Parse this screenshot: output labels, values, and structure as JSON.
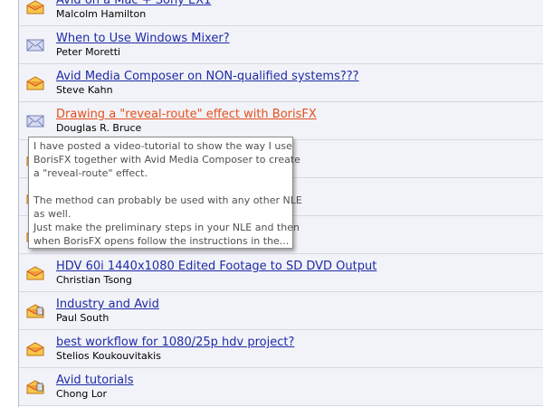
{
  "threads": [
    {
      "title": "Avid on a Mac + Sony EX1",
      "author": "Malcolm Hamilton",
      "icon": "envelope-open-icon"
    },
    {
      "title": "When to Use Windows Mixer?",
      "author": "Peter Moretti",
      "icon": "envelope-closed-icon"
    },
    {
      "title": "Avid Media Composer on NON-qualified systems???",
      "author": "Steve Kahn",
      "icon": "envelope-open-icon"
    },
    {
      "title": "Drawing a \"reveal-route\" effect with BorisFX",
      "author": "Douglas R. Bruce",
      "icon": "envelope-closed-icon"
    },
    {
      "title": "",
      "author": "",
      "icon": "envelope-open-icon"
    },
    {
      "title": "",
      "author": "",
      "icon": "envelope-open-icon"
    },
    {
      "title": "",
      "author": "",
      "icon": "envelope-open-icon"
    },
    {
      "title": "HDV 60i 1440x1080 Edited Footage to SD DVD Output",
      "author": "Christian Tsong",
      "icon": "envelope-open-icon"
    },
    {
      "title": "Industry and Avid",
      "author": "Paul South",
      "icon": "envelope-reply-icon"
    },
    {
      "title": "best workflow for 1080/25p hdv project?",
      "author": "Stelios Koukouvitakis",
      "icon": "envelope-open-icon"
    },
    {
      "title": "Avid tutorials",
      "author": "Chong Lor",
      "icon": "envelope-reply-icon"
    }
  ],
  "tooltip": {
    "line1": "I have posted a video-tutorial to show the way I use",
    "line2": "BorisFX together with Avid Media Composer to create",
    "line3": "a \"reveal-route\" effect.",
    "line4": "The method can probably be used with any other NLE",
    "line5": "as well.",
    "line6": "Just make the preliminary steps in your NLE and then",
    "line7": "when BorisFX opens follow the instructions in the..."
  },
  "colors": {
    "link": "#1e2ba6",
    "link_hover": "#e5501c",
    "row_bg": "#f2f3f8"
  }
}
